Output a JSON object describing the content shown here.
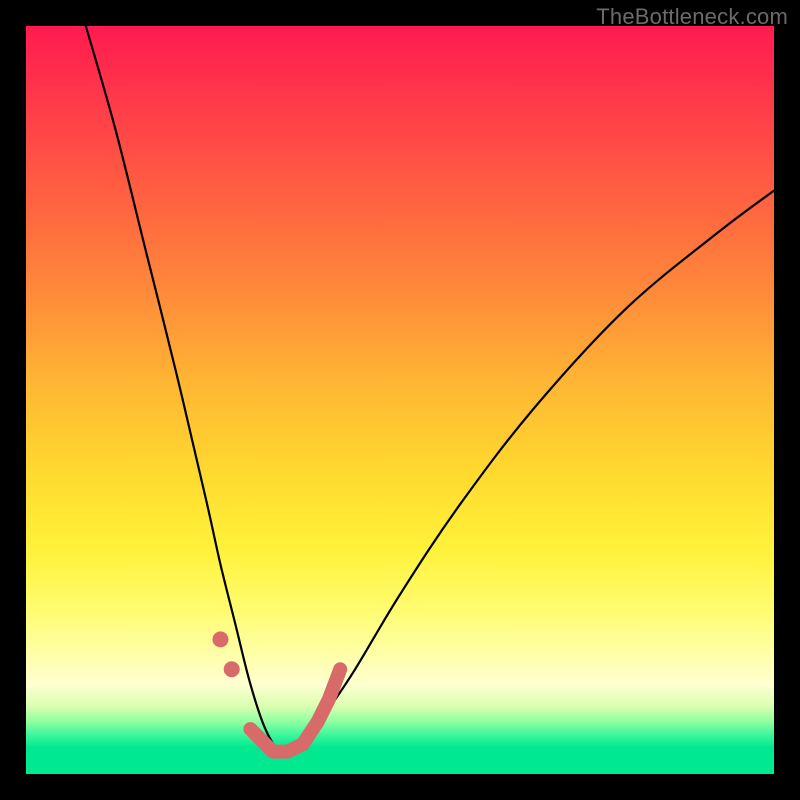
{
  "watermark": "TheBottleneck.com",
  "colors": {
    "gradient_top": "#ff1a50",
    "gradient_mid": "#ffe03a",
    "gradient_bottom": "#00e890",
    "curve": "#000000",
    "markers": "#d86a6a",
    "frame": "#000000"
  },
  "chart_data": {
    "type": "line",
    "title": "",
    "xlabel": "",
    "ylabel": "",
    "xlim": [
      0,
      100
    ],
    "ylim": [
      0,
      100
    ],
    "grid": false,
    "note": "Axis values are normalized estimates; background gradient encodes bottleneck severity (red=high, green=low) and the curve depicts bottleneck % with a minimum near x≈34.",
    "series": [
      {
        "name": "bottleneck-curve",
        "x": [
          8,
          12,
          16,
          20,
          24,
          26,
          28,
          30,
          32,
          34,
          36,
          38,
          40,
          44,
          50,
          58,
          68,
          80,
          92,
          100
        ],
        "y": [
          100,
          86,
          70,
          54,
          37,
          28,
          20,
          12,
          6,
          3,
          3,
          5,
          8,
          14,
          24,
          36,
          49,
          62,
          72,
          78
        ]
      }
    ],
    "markers": {
      "name": "highlighted-region-near-minimum",
      "x": [
        26,
        27.5,
        30,
        33,
        35,
        37,
        39,
        40.5,
        42
      ],
      "y": [
        18,
        14,
        6,
        3,
        3,
        4,
        7,
        10,
        14
      ]
    }
  }
}
